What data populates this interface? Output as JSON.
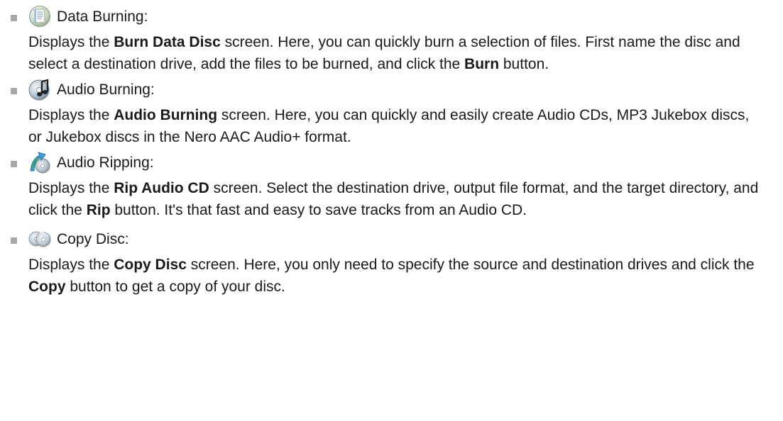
{
  "items": [
    {
      "title": "Data Burning:",
      "icon": "data-disc-icon",
      "desc": [
        {
          "t": "Displays the ",
          "b": false
        },
        {
          "t": "Burn Data Disc",
          "b": true
        },
        {
          "t": " screen. Here, you can quickly burn a selection of files. First name the disc and select a destination drive, add the files to be burned, and click the ",
          "b": false
        },
        {
          "t": "Burn",
          "b": true
        },
        {
          "t": " button.",
          "b": false
        }
      ]
    },
    {
      "title": "Audio Burning:",
      "icon": "audio-disc-icon",
      "desc": [
        {
          "t": "Displays the ",
          "b": false
        },
        {
          "t": "Audio Burning",
          "b": true
        },
        {
          "t": " screen. Here, you can quickly and easily create Audio CDs, MP3 Jukebox discs, or Jukebox discs in the Nero AAC Audio+ format.",
          "b": false
        }
      ]
    },
    {
      "title": "Audio Ripping:",
      "icon": "audio-rip-icon",
      "desc": [
        {
          "t": "Displays the ",
          "b": false
        },
        {
          "t": "Rip Audio CD",
          "b": true
        },
        {
          "t": " screen. Select the destination drive, output file format, and the target directory, and click the ",
          "b": false
        },
        {
          "t": "Rip",
          "b": true
        },
        {
          "t": " button. It's that fast and easy to save tracks from an Audio CD.",
          "b": false
        }
      ]
    },
    {
      "title": "Copy Disc:",
      "icon": "copy-disc-icon",
      "desc": [
        {
          "t": "Displays the ",
          "b": false
        },
        {
          "t": "Copy Disc",
          "b": true
        },
        {
          "t": " screen. Here, you only need to specify the source and destination drives and click the ",
          "b": false
        },
        {
          "t": "Copy",
          "b": true
        },
        {
          "t": " button to get a copy of your disc.",
          "b": false
        }
      ]
    }
  ]
}
